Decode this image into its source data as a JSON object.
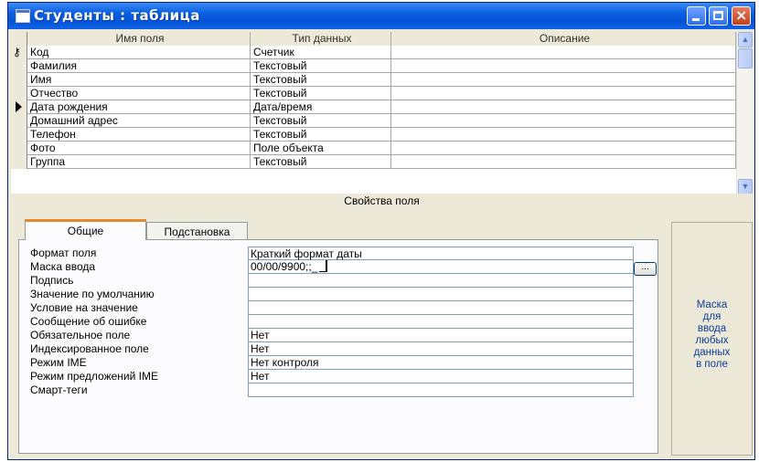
{
  "window": {
    "title": "Студенты : таблица"
  },
  "grid": {
    "headers": [
      "Имя поля",
      "Тип данных",
      "Описание"
    ],
    "rows": [
      {
        "name": "Код",
        "type": "Счетчик",
        "desc": "",
        "marker": "key"
      },
      {
        "name": "Фамилия",
        "type": "Текстовый",
        "desc": "",
        "marker": ""
      },
      {
        "name": "Имя",
        "type": "Текстовый",
        "desc": "",
        "marker": ""
      },
      {
        "name": "Отчество",
        "type": "Текстовый",
        "desc": "",
        "marker": ""
      },
      {
        "name": "Дата рождения",
        "type": "Дата/время",
        "desc": "",
        "marker": "current"
      },
      {
        "name": "Домашний адрес",
        "type": "Текстовый",
        "desc": "",
        "marker": ""
      },
      {
        "name": "Телефон",
        "type": "Текстовый",
        "desc": "",
        "marker": ""
      },
      {
        "name": "Фото",
        "type": "Поле объекта",
        "desc": "",
        "marker": ""
      },
      {
        "name": "Группа",
        "type": "Текстовый",
        "desc": "",
        "marker": ""
      }
    ]
  },
  "properties": {
    "caption": "Свойства поля",
    "tabs": [
      "Общие",
      "Подстановка"
    ],
    "active_tab": "Общие",
    "rows": [
      {
        "label": "Формат поля",
        "value": "Краткий формат даты"
      },
      {
        "label": "Маска ввода",
        "value": "00/00/9900;;_"
      },
      {
        "label": "Подпись",
        "value": ""
      },
      {
        "label": "Значение по умолчанию",
        "value": ""
      },
      {
        "label": "Условие на значение",
        "value": ""
      },
      {
        "label": "Сообщение об ошибке",
        "value": ""
      },
      {
        "label": "Обязательное поле",
        "value": "Нет"
      },
      {
        "label": "Индексированное поле",
        "value": "Нет"
      },
      {
        "label": "Режим IME",
        "value": "Нет контроля"
      },
      {
        "label": "Режим предложений IME",
        "value": "Нет"
      },
      {
        "label": "Смарт-теги",
        "value": ""
      }
    ],
    "build_button": "..."
  },
  "help": {
    "lines": [
      "Маска",
      "для",
      "ввода",
      "любых",
      "данных",
      "в поле"
    ]
  },
  "colors": {
    "titlebar": "#0554d8",
    "help_text": "#0b3b9b",
    "active_tab_accent": "#e68b2c"
  }
}
